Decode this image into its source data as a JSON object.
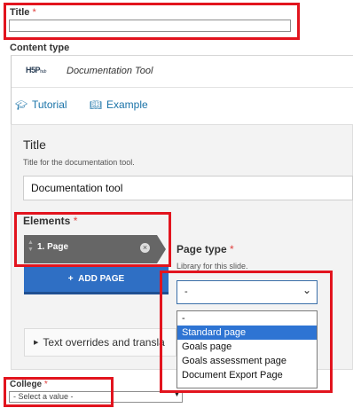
{
  "title_field": {
    "label": "Title",
    "required_mark": "*",
    "value": ""
  },
  "content_type": {
    "label": "Content type",
    "logo_text": "H5P",
    "logo_sub": "hub",
    "tool_name": "Documentation Tool",
    "links": [
      {
        "icon": "graduation-cap-icon",
        "label": "Tutorial"
      },
      {
        "icon": "book-icon",
        "label": "Example"
      }
    ]
  },
  "editor": {
    "title_label": "Title",
    "title_desc": "Title for the documentation tool.",
    "title_value": "Documentation tool",
    "elements_label": "Elements",
    "required_mark": "*",
    "page_tab": "1. Page",
    "add_page": "ADD PAGE",
    "page_type": {
      "label": "Page type",
      "desc": "Library for this slide.",
      "selected": "-",
      "options": [
        "-",
        "Standard page",
        "Goals page",
        "Goals assessment page",
        "Document Export Page"
      ],
      "highlighted": "Standard page"
    },
    "overrides": "Text overrides and transla"
  },
  "college": {
    "label": "College",
    "required_mark": "*",
    "value": "- Select a value -"
  },
  "colors": {
    "highlight": "#e2141e",
    "accent": "#2f6fc4",
    "selected_option": "#2e74d3"
  }
}
